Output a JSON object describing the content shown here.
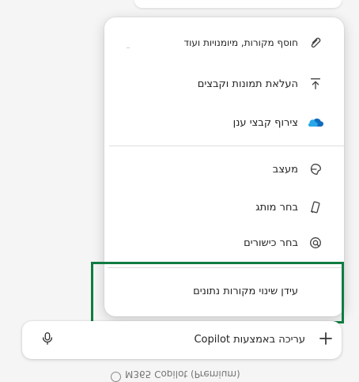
{
  "menu": {
    "items": [
      {
        "label": "חוסף מקורות, מיומנויות ועוד",
        "icon": "paperclip-icon"
      },
      {
        "label": "העלאת תמונות וקבצים",
        "icon": "upload-icon"
      },
      {
        "label": "צירוף קבצי ענן",
        "icon": "onedrive-cloud-icon"
      },
      {
        "label": "מעצב",
        "icon": "designer-icon"
      },
      {
        "label": "בחר מותג",
        "icon": "brand-phone-icon"
      },
      {
        "label": "בחר כישורים",
        "icon": "skills-icon"
      },
      {
        "label": "עידן שינוי מקורות נתונים",
        "icon": "data-source-icon"
      }
    ]
  },
  "composer": {
    "placeholder": "עריכה באמצעות Copilot"
  },
  "footer": {
    "text": "M365 Copilot (Premium)"
  },
  "colors": {
    "highlight": "#107c41",
    "onedrive": "#0f6cbd"
  }
}
